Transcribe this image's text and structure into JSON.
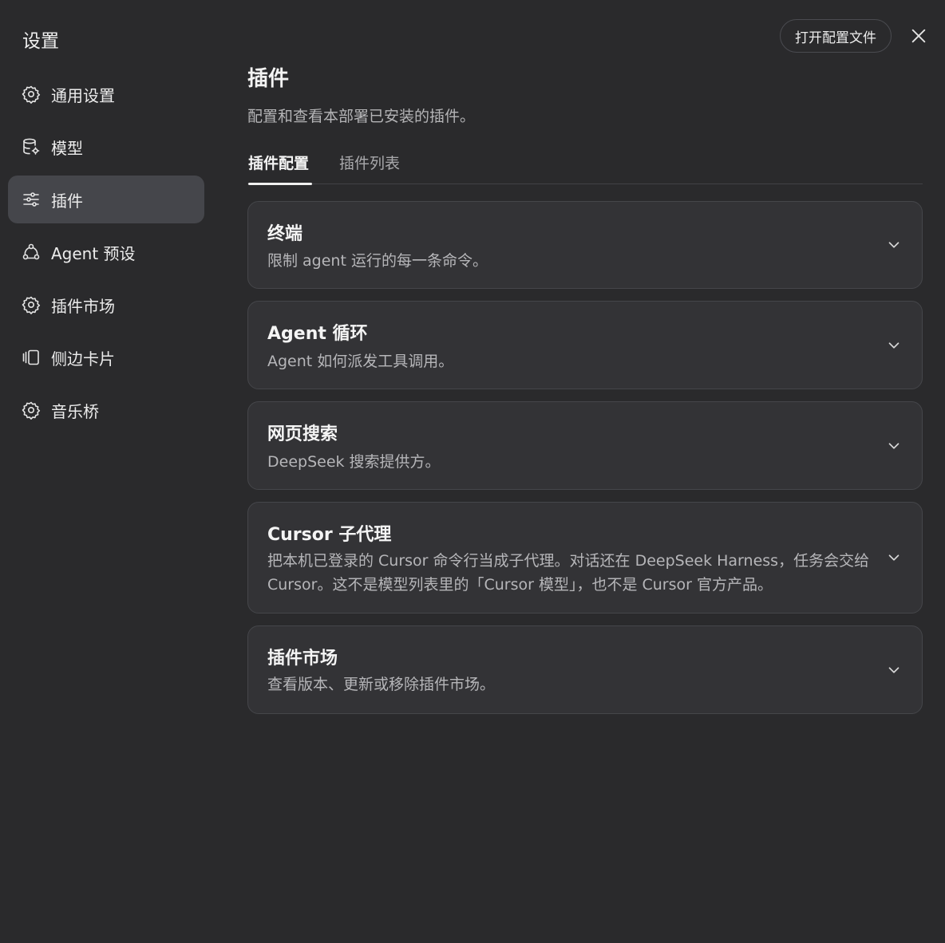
{
  "sidebar": {
    "title": "设置",
    "items": [
      {
        "label": "通用设置",
        "icon": "gear-icon",
        "active": false
      },
      {
        "label": "模型",
        "icon": "database-gear-icon",
        "active": false
      },
      {
        "label": "插件",
        "icon": "sliders-icon",
        "active": true
      },
      {
        "label": "Agent 预设",
        "icon": "nodes-icon",
        "active": false
      },
      {
        "label": "插件市场",
        "icon": "gear-icon",
        "active": false
      },
      {
        "label": "侧边卡片",
        "icon": "cards-icon",
        "active": false
      },
      {
        "label": "音乐桥",
        "icon": "gear-icon",
        "active": false
      }
    ]
  },
  "header": {
    "open_config_label": "打开配置文件",
    "close_icon": "close-icon"
  },
  "main": {
    "title": "插件",
    "description": "配置和查看本部署已安装的插件。",
    "tabs": [
      {
        "label": "插件配置",
        "active": true
      },
      {
        "label": "插件列表",
        "active": false
      }
    ],
    "cards": [
      {
        "title": "终端",
        "description": "限制 agent 运行的每一条命令。"
      },
      {
        "title": "Agent 循环",
        "description": "Agent 如何派发工具调用。"
      },
      {
        "title": "网页搜索",
        "description": "DeepSeek 搜索提供方。"
      },
      {
        "title": "Cursor 子代理",
        "description_line1": "把本机已登录的 Cursor 命令行当成子代理。对话还在 DeepSeek Harness，任务会交给",
        "description_line2": "Cursor。这不是模型列表里的「Cursor 模型」，也不是 Cursor 官方产品。"
      },
      {
        "title": "插件市场",
        "description": "查看版本、更新或移除插件市场。"
      }
    ]
  }
}
